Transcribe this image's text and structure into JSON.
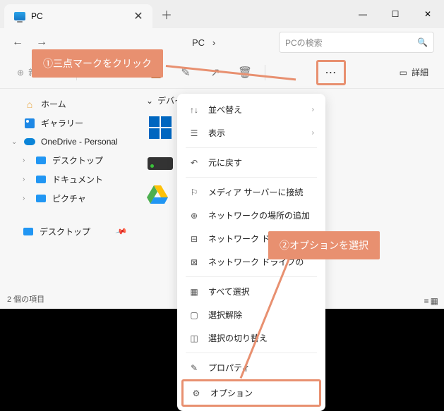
{
  "tab": {
    "title": "PC"
  },
  "breadcrumb": {
    "current": "PC"
  },
  "search": {
    "placeholder": "PCの検索"
  },
  "toolbar": {
    "new_label": "新規作成",
    "detail_label": "詳細"
  },
  "sidebar": {
    "home": "ホーム",
    "gallery": "ギャラリー",
    "onedrive": "OneDrive - Personal",
    "desktop": "デスクトップ",
    "documents": "ドキュメント",
    "pictures": "ピクチャ",
    "desktop2": "デスクトップ"
  },
  "main": {
    "section": "デバイス"
  },
  "status": {
    "items": "2 個の項目"
  },
  "menu": {
    "sort": "並べ替え",
    "view": "表示",
    "undo": "元に戻す",
    "media": "メディア サーバーに接続",
    "netloc": "ネットワークの場所の追加",
    "netdrive1": "ネットワーク ドライブの",
    "netdrive2": "ネットワーク ドライブの",
    "selectall": "すべて選択",
    "deselect": "選択解除",
    "toggleselect": "選択の切り替え",
    "properties": "プロパティ",
    "options": "オプション"
  },
  "callout1": "①三点マークをクリック",
  "callout2": "②オプションを選択"
}
